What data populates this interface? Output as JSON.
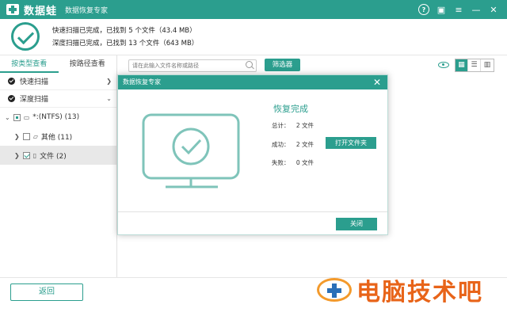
{
  "titlebar": {
    "brand": "数据蛙",
    "subtitle": "数据恢复专家",
    "icons": [
      "help-icon",
      "save-icon",
      "menu-icon",
      "minimize-icon",
      "close-icon"
    ]
  },
  "summary": {
    "quick_scan": "快速扫描已完成，已找到 5 个文件（43.4 MB）",
    "deep_scan": "深度扫描已完成，已找到 13 个文件（643 MB）"
  },
  "sidebar": {
    "tabs": [
      "按类型查看",
      "按路径查看"
    ],
    "scan_items": [
      "快速扫描",
      "深度扫描"
    ],
    "tree": [
      {
        "label": "*:(NTFS) (13)"
      },
      {
        "label": "其他 (11)"
      },
      {
        "label": "文件 (2)"
      }
    ]
  },
  "toolbar": {
    "search_placeholder": "请在此输入文件名称或路径",
    "filter_label": "筛选器"
  },
  "footer": {
    "back_label": "返回"
  },
  "watermark": {
    "text": "电脑技术吧"
  },
  "dialog": {
    "title": "数据恢复专家",
    "heading": "恢复完成",
    "total_label": "总计：",
    "total_value": "2 文件",
    "success_label": "成功：",
    "success_value": "2 文件",
    "fail_label": "失败：",
    "fail_value": "0 文件",
    "open_folder_label": "打开文件夹",
    "close_label": "关闭"
  },
  "colors": {
    "accent": "#2b9e8e",
    "watermark": "#e86419"
  }
}
